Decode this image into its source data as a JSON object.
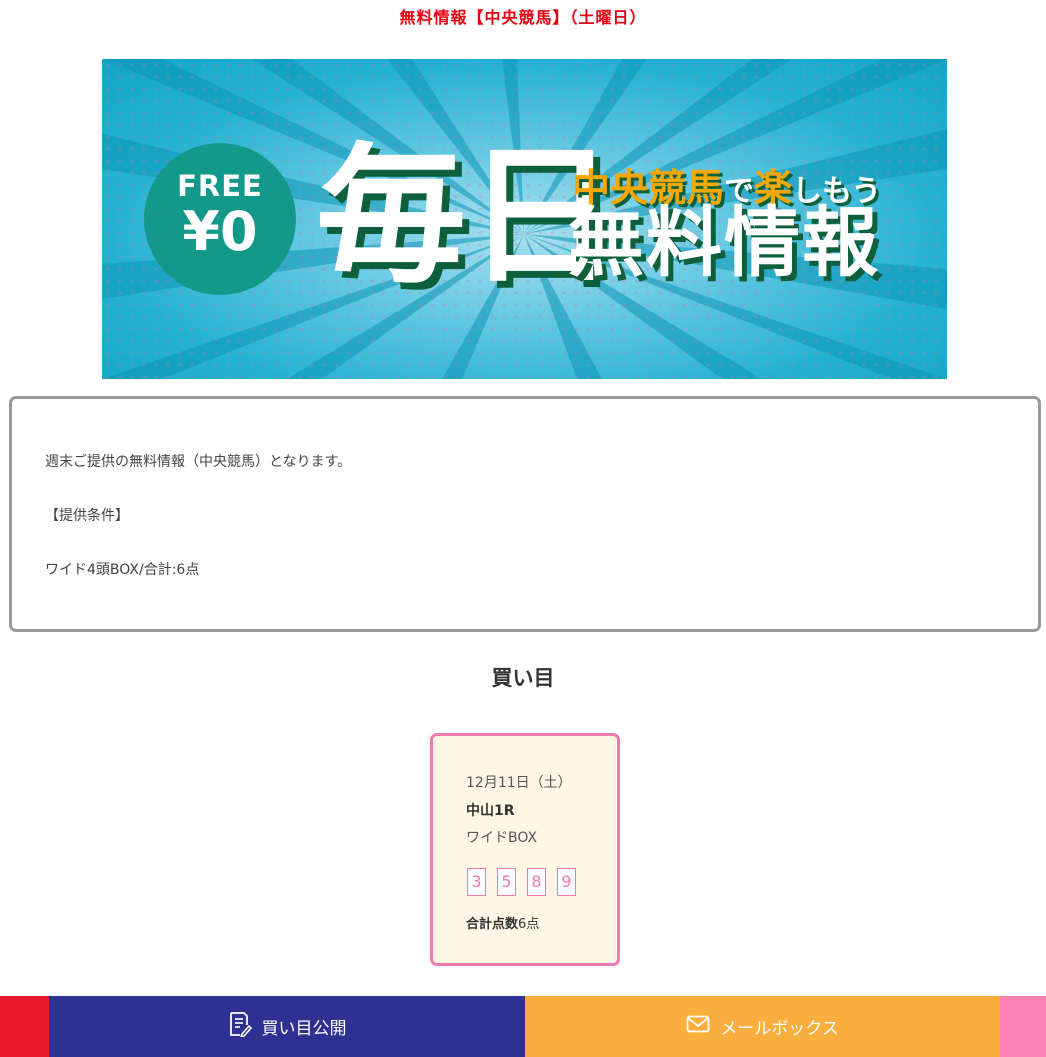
{
  "page": {
    "title": "無料情報【中央競馬】（土曜日）"
  },
  "banner": {
    "free_label": "FREE",
    "price_label": "¥0",
    "big_text": "毎日",
    "sub_text_a": "中央競馬",
    "sub_text_b": "で",
    "sub_text_c": "楽",
    "sub_text_d": "しもう",
    "main_text": "無料情報",
    "colors": {
      "background": "#24b2d2",
      "badge": "#13998a",
      "accent": "#f6a800",
      "shadow": "#0e5f3c"
    }
  },
  "info": {
    "line1": "週末ご提供の無料情報（中央競馬）となります。",
    "line2": "【提供条件】",
    "line3": "ワイド4頭BOX/合計:6点"
  },
  "picks": {
    "heading": "買い目",
    "card": {
      "date": "12月11日（土）",
      "race": "中山1R",
      "bet_type": "ワイドBOX",
      "numbers": [
        "3",
        "5",
        "8",
        "9"
      ],
      "total_label": "合計点数",
      "total_value": "6点"
    }
  },
  "footer": {
    "picks_button": {
      "label": "買い目公開",
      "icon": "document-pen-icon"
    },
    "mail_button": {
      "label": "メールボックス",
      "icon": "mail-icon"
    },
    "colors": {
      "left_edge": "#e8162d",
      "picks": "#2e3192",
      "mail": "#f9ae3d",
      "right_edge": "#fb82b4"
    }
  }
}
